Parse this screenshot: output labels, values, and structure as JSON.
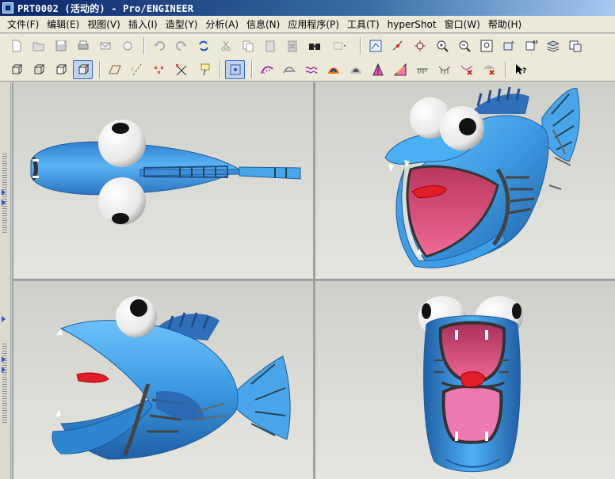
{
  "window": {
    "title": "PRT0002 (活动的) - Pro/ENGINEER"
  },
  "menu": {
    "items": [
      "文件(F)",
      "编辑(E)",
      "视图(V)",
      "插入(I)",
      "造型(Y)",
      "分析(A)",
      "信息(N)",
      "应用程序(P)",
      "工具(T)",
      "hyperShot",
      "窗口(W)",
      "帮助(H)"
    ]
  },
  "toolbar_top": {
    "icons": [
      "new-icon",
      "open-icon",
      "save-icon",
      "print-icon",
      "email-icon",
      "email-link-icon",
      "undo-icon",
      "redo-icon",
      "regenerate-icon",
      "cut-icon",
      "copy-icon",
      "paste-icon",
      "paste-special-icon",
      "find-icon",
      "select-box-icon",
      "redraw-icon",
      "spin-center-icon",
      "orient-mode-icon",
      "zoom-in-icon",
      "zoom-out-icon",
      "refit-icon",
      "reorient-icon",
      "saved-views-icon",
      "layers-icon",
      "view-manager-icon"
    ]
  },
  "toolbar_bottom": {
    "icons": [
      "wireframe-icon",
      "hidden-line-icon",
      "no-hidden-icon",
      "shading-icon",
      "datum-planes-icon",
      "datum-axes-icon",
      "datum-points-icon",
      "coordinate-systems-icon",
      "annotation-icon",
      "style-surface-icon",
      "curvature-icon",
      "curve-analysis-icon",
      "reflection-icon",
      "draft-analysis-icon",
      "slope-icon",
      "shade-curvature-icon",
      "section-icon",
      "offset-icon",
      "deviation-icon",
      "connection-icon",
      "dihedral-icon",
      "whats-this-icon"
    ],
    "active": "shading-icon"
  },
  "viewports": [
    "vp-top-view",
    "vp-iso-front",
    "vp-side-view",
    "vp-front-view"
  ],
  "colors": {
    "fish_body": "#3d9ee6",
    "fish_shadow": "#1f6fb8",
    "mouth": "#e8557f",
    "tongue": "#e01e2a",
    "eye_white": "#ffffff",
    "pupil": "#000000",
    "fin_dark": "#244f8f"
  }
}
